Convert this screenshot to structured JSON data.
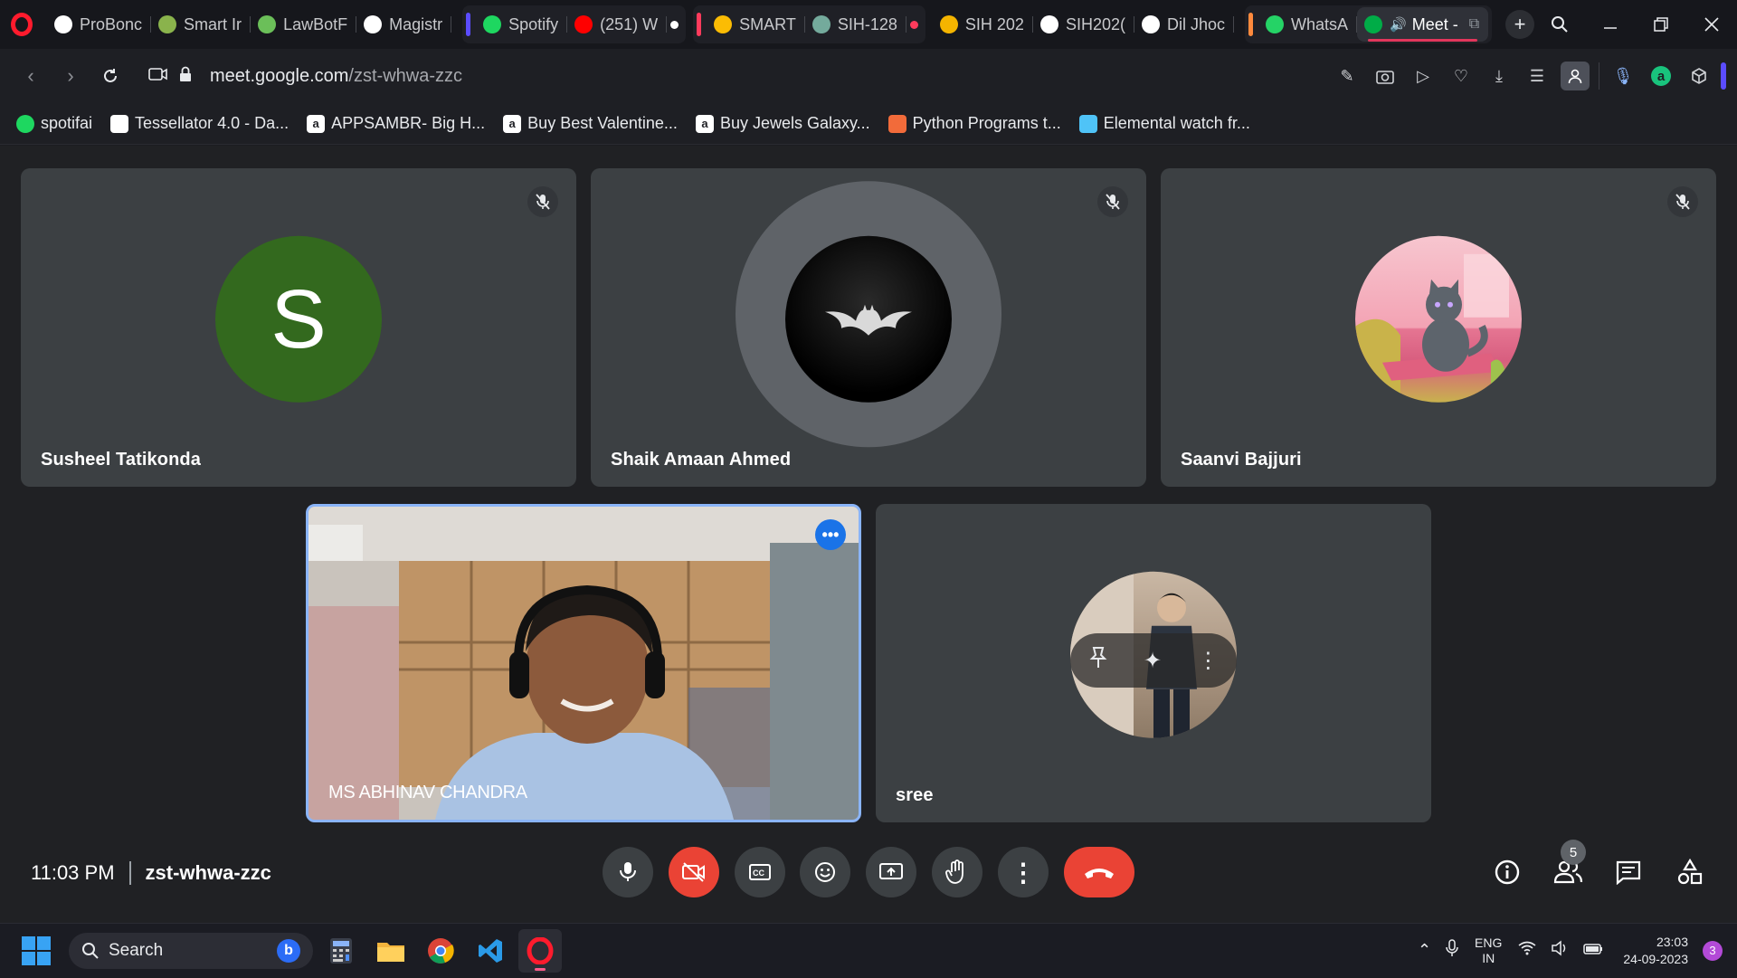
{
  "browser": {
    "tabs": [
      {
        "label": "ProBonc",
        "icon": "robot-icon",
        "color": "#ffffff"
      },
      {
        "label": "Smart Ir",
        "icon": "map-pin-icon",
        "color": "#8ab34c"
      },
      {
        "label": "LawBotF",
        "icon": "map-pin-icon",
        "color": "#6bbf59"
      },
      {
        "label": "Magistr",
        "icon": "google-icon",
        "color": "#ffffff"
      },
      {
        "label": "Spotify",
        "icon": "spotify-icon",
        "color": "#1ed760"
      },
      {
        "label": "(251) W",
        "icon": "youtube-icon",
        "color": "#ff0000"
      },
      {
        "label": "SMART",
        "icon": "drive-icon",
        "color": "#fbbc04"
      },
      {
        "label": "SIH-128",
        "icon": "chatgpt-icon",
        "color": "#74aa9c"
      },
      {
        "label": "SIH 202",
        "icon": "slides-icon",
        "color": "#f4b400"
      },
      {
        "label": "SIH202(",
        "icon": "globe-icon",
        "color": "#ffffff"
      },
      {
        "label": "Dil Jhoc",
        "icon": "globe-icon",
        "color": "#ffffff"
      },
      {
        "label": "WhatsA",
        "icon": "whatsapp-icon",
        "color": "#25d366"
      },
      {
        "label": "Meet -",
        "icon": "meet-icon",
        "color": "#00ac47"
      }
    ],
    "url_domain": "meet.google.com",
    "url_path": "/zst-whwa-zzc",
    "bookmarks": [
      {
        "label": "spotifai",
        "icon": "spotify-icon",
        "color": "#1ed760"
      },
      {
        "label": "Tessellator 4.0 - Da...",
        "icon": "tessellator-icon",
        "color": "#ffffff"
      },
      {
        "label": "APPSAMBR- Big H...",
        "icon": "amazon-icon",
        "color": "#ffffff"
      },
      {
        "label": "Buy Best Valentine...",
        "icon": "amazon-icon",
        "color": "#ffffff"
      },
      {
        "label": "Buy Jewels Galaxy...",
        "icon": "amazon-icon",
        "color": "#ffffff"
      },
      {
        "label": "Python Programs t...",
        "icon": "python-icon",
        "color": "#f26b3a"
      },
      {
        "label": "Elemental watch fr...",
        "icon": "elemental-icon",
        "color": "#4fc3f7"
      }
    ]
  },
  "meet": {
    "participants": [
      {
        "name": "Susheel Tatikonda",
        "initial": "S",
        "avatar_color": "#33691e",
        "muted": true
      },
      {
        "name": "Shaik Amaan Ahmed",
        "avatar": "batman-logo",
        "muted": true,
        "speaking_halo": true
      },
      {
        "name": "Saanvi Bajjuri",
        "avatar": "cat-illustration",
        "muted": true
      },
      {
        "name": "MS ABHINAV CHANDRA",
        "video": true,
        "self": true
      },
      {
        "name": "sree",
        "avatar": "person-photo",
        "hovered": true
      }
    ],
    "time": "11:03 PM",
    "meeting_code": "zst-whwa-zzc",
    "people_count": "5"
  },
  "taskbar": {
    "search_placeholder": "Search",
    "lang_line1": "ENG",
    "lang_line2": "IN",
    "clock_time": "23:03",
    "clock_date": "24-09-2023",
    "notification_count": "3"
  }
}
